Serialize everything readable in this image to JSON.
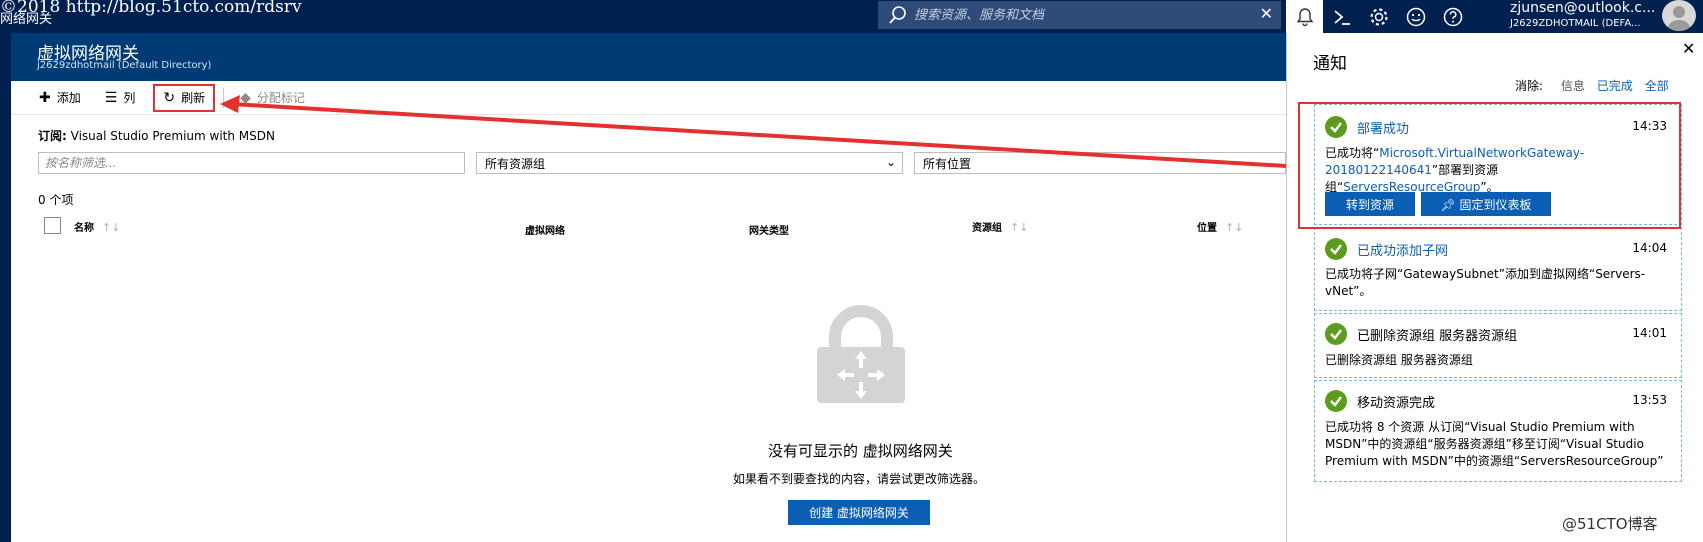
{
  "watermark_top": "©2018 http://blog.51cto.com/rdsrv",
  "app_title": "网络网关",
  "search": {
    "placeholder": "搜索资源、服务和文档",
    "clear": "✕"
  },
  "user": {
    "email": "zjunsen@outlook.c...",
    "directory": "J2629ZDHOTMAIL (DEFA..."
  },
  "blade": {
    "title": "虚拟网络网关",
    "subtitle": "j2629zdhotmail (Default Directory)"
  },
  "toolbar": {
    "add_label": "添加",
    "columns_label": "列",
    "refresh_label": "刷新",
    "tags_label": "分配标记"
  },
  "subscription": {
    "label": "订阅:",
    "value": "Visual Studio Premium with MSDN"
  },
  "filters": {
    "name_placeholder": "按名称筛选...",
    "resource_group": "所有资源组",
    "location": "所有位置"
  },
  "count": "0 个项",
  "columns": {
    "name": "名称",
    "vnet": "虚拟网络",
    "gateway_type": "网关类型",
    "resource_group": "资源组",
    "location": "位置"
  },
  "empty": {
    "title": "没有可显示的 虚拟网络网关",
    "description": "如果看不到要查找的内容，请尝试更改筛选器。",
    "create_label": "创建 虚拟网络网关"
  },
  "notifications": {
    "title": "通知",
    "close": "✕",
    "dismiss_label": "消除:",
    "dismiss_info": "信息",
    "dismiss_done": "已完成",
    "dismiss_all": "全部",
    "items": [
      {
        "title": "部署成功",
        "time": "14:33",
        "body_prefix": "已成功将“",
        "body_link1": "Microsoft.VirtualNetworkGateway-20180122140641",
        "body_mid": "”部署到资源组“",
        "body_link2": "ServersResourceGroup",
        "body_suffix": "”。",
        "go_to_resource": "转到资源",
        "pin_to_dashboard": "固定到仪表板"
      },
      {
        "title": "已成功添加子网",
        "time": "14:04",
        "body": "已成功将子网“GatewaySubnet”添加到虚拟网络“Servers-vNet”。"
      },
      {
        "title": "已删除资源组 服务器资源组",
        "time": "14:01",
        "body": "已删除资源组 服务器资源组"
      },
      {
        "title": "移动资源完成",
        "time": "13:53",
        "body": "已成功将 8 个资源 从订阅“Visual Studio Premium with MSDN”中的资源组“服务器资源组”移至订阅“Visual Studio Premium with MSDN”中的资源组“ServersResourceGroup”"
      }
    ]
  },
  "watermark_bottom": "@51CTO博客",
  "colors": {
    "topbar": "#002050",
    "blade_header": "#003b76",
    "accent": "#0a5fb4",
    "success": "#5c9b1d",
    "annotation": "#e53030"
  }
}
